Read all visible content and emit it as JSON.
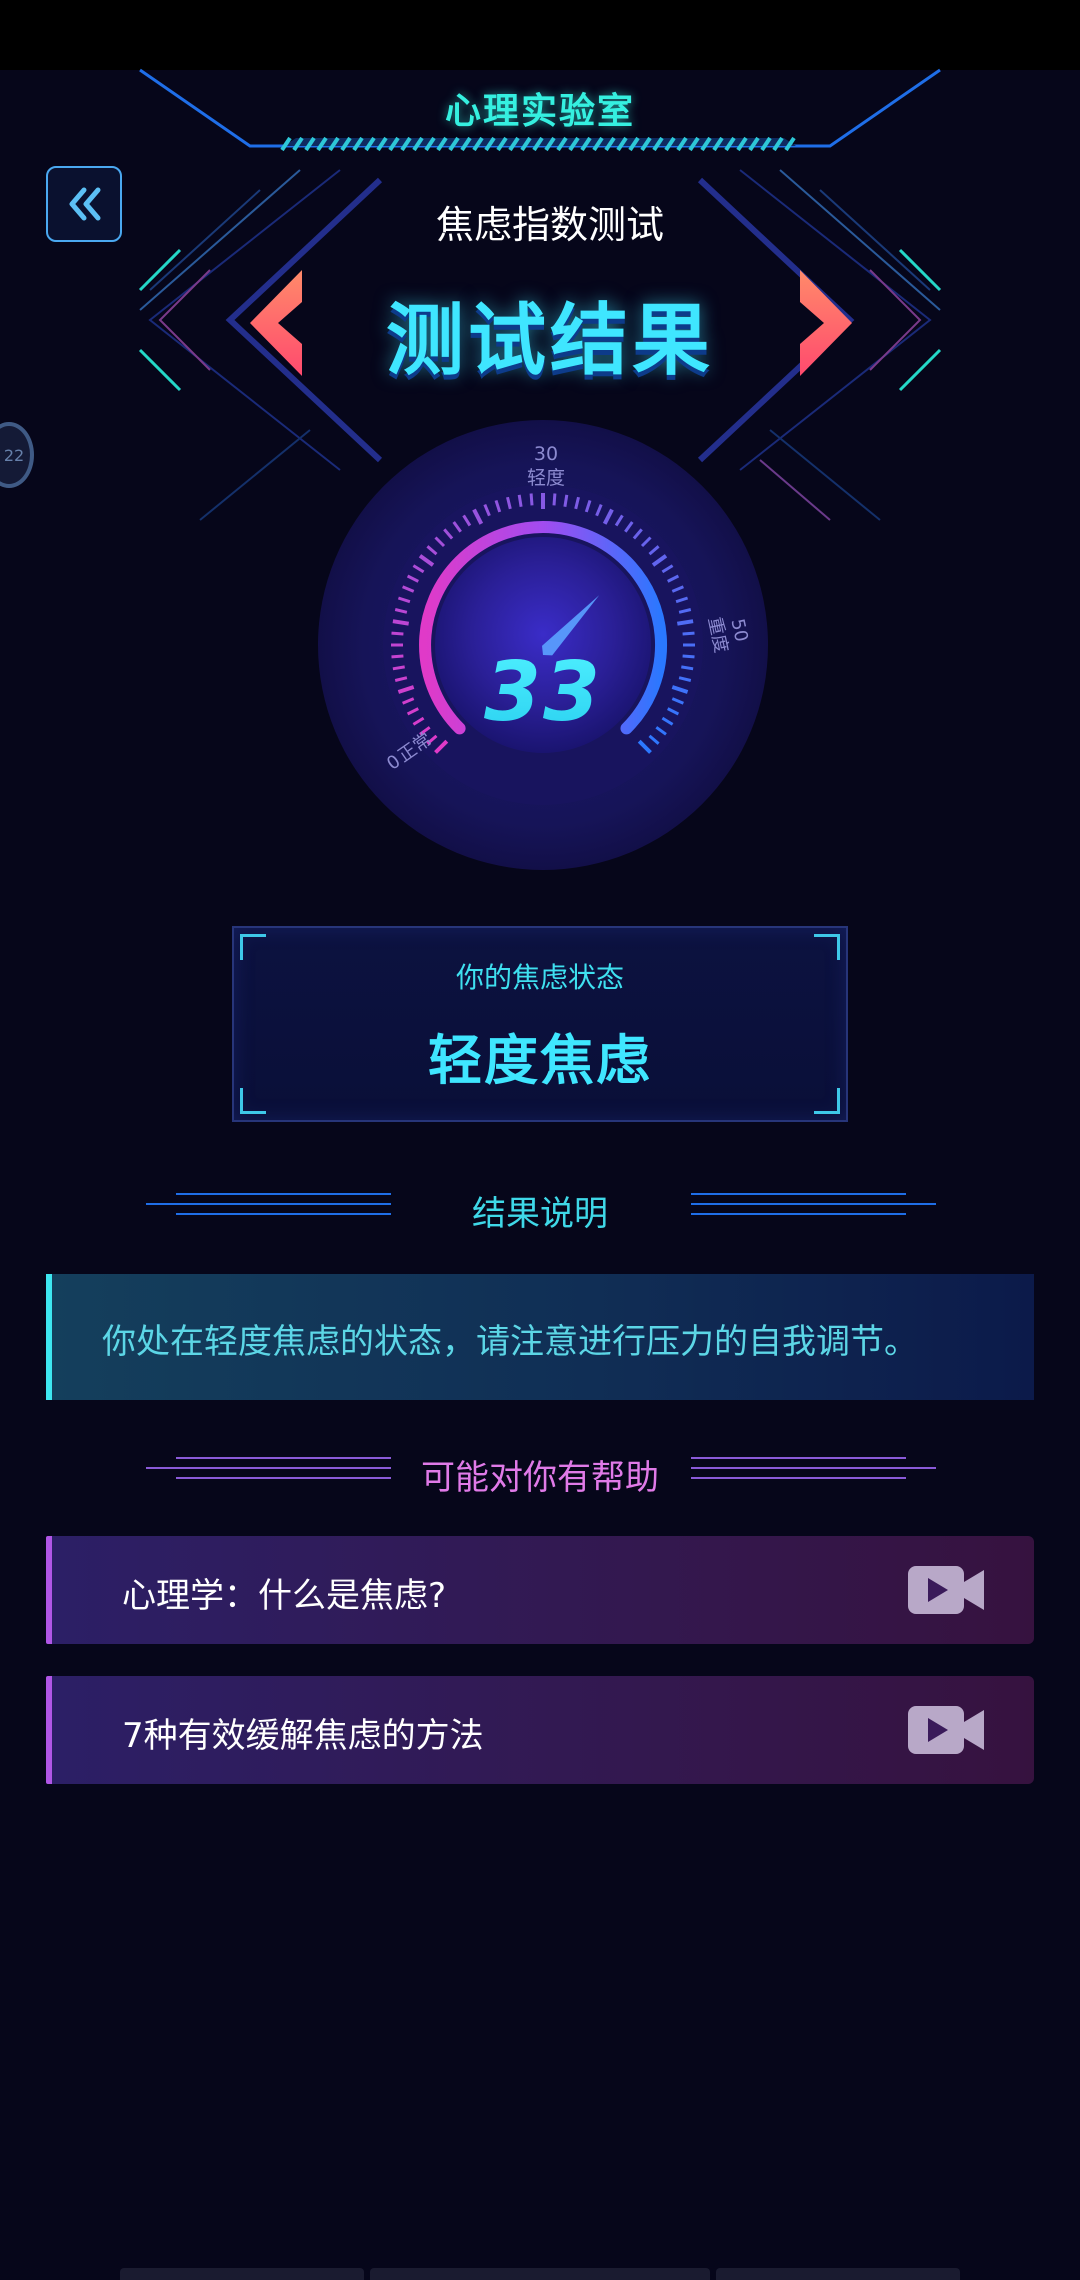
{
  "header": {
    "lab_title": "心理实验室",
    "test_name": "焦虑指数测试",
    "result_title": "测试结果"
  },
  "side_badge": {
    "text": "22"
  },
  "gauge": {
    "score": "33",
    "value": 33,
    "min": 0,
    "max": 50,
    "min_label": "0",
    "min_tag": "正常",
    "mid_value": "30",
    "mid_tag": "轻度",
    "max_value": "50",
    "max_tag": "重度"
  },
  "status": {
    "label": "你的焦虑状态",
    "value": "轻度焦虑"
  },
  "explanation": {
    "heading": "结果说明",
    "text": "你处在轻度焦虑的状态，请注意进行压力的自我调节。"
  },
  "help": {
    "heading": "可能对你有帮助",
    "items": [
      {
        "label": "心理学：什么是焦虑?",
        "icon": "video-icon"
      },
      {
        "label": "7种有效缓解焦虑的方法",
        "icon": "video-icon"
      }
    ]
  },
  "colors": {
    "background": "#06061a",
    "accent_cyan": "#3fe6ff",
    "accent_purple": "#b056e6",
    "arrow_red": "#ff5a6e"
  }
}
